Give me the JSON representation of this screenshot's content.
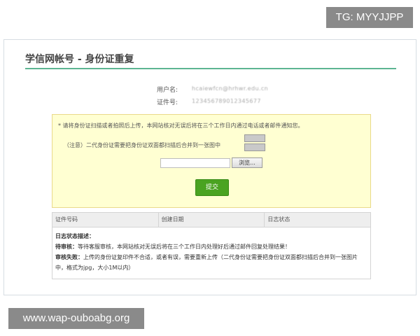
{
  "overlay": {
    "tg_badge": "TG: MYYJJPP",
    "watermark": "www.wap-ouboabg.org"
  },
  "page": {
    "title": "学信网帐号 - 身份证重复"
  },
  "account": {
    "username_label": "用户名:",
    "username_value": "hcaiewfcn@hrhwr.edu.cn",
    "id_label": "证件号:",
    "id_value": "123456789012345677"
  },
  "notice": {
    "instruction": "* 请将身份证扫描或者拍照后上传，本网站核对无误后将在三个工作日内通过电话或者邮件通知您。",
    "note": "（注意）二代身份证需要把身份证双面都扫描后合并到一张图中",
    "browse_label": "浏览...",
    "submit_label": "提交"
  },
  "table": {
    "columns": [
      "证件号码",
      "创建日期",
      "日志状态"
    ],
    "desc_title": "日志状态描述：",
    "pending_label": "待审核：",
    "pending_text": "等待客服审核，本网站核对无误后将在三个工作日内处理好后通过邮件回复处理结果！",
    "failed_label": "审核失败：",
    "failed_text": "上传的身份证复印件不合适，或者有误，需要重新上传（二代身份证需要把身份证双面都扫描后合并到一张图片中，格式为jpg，大小1M以内）"
  }
}
